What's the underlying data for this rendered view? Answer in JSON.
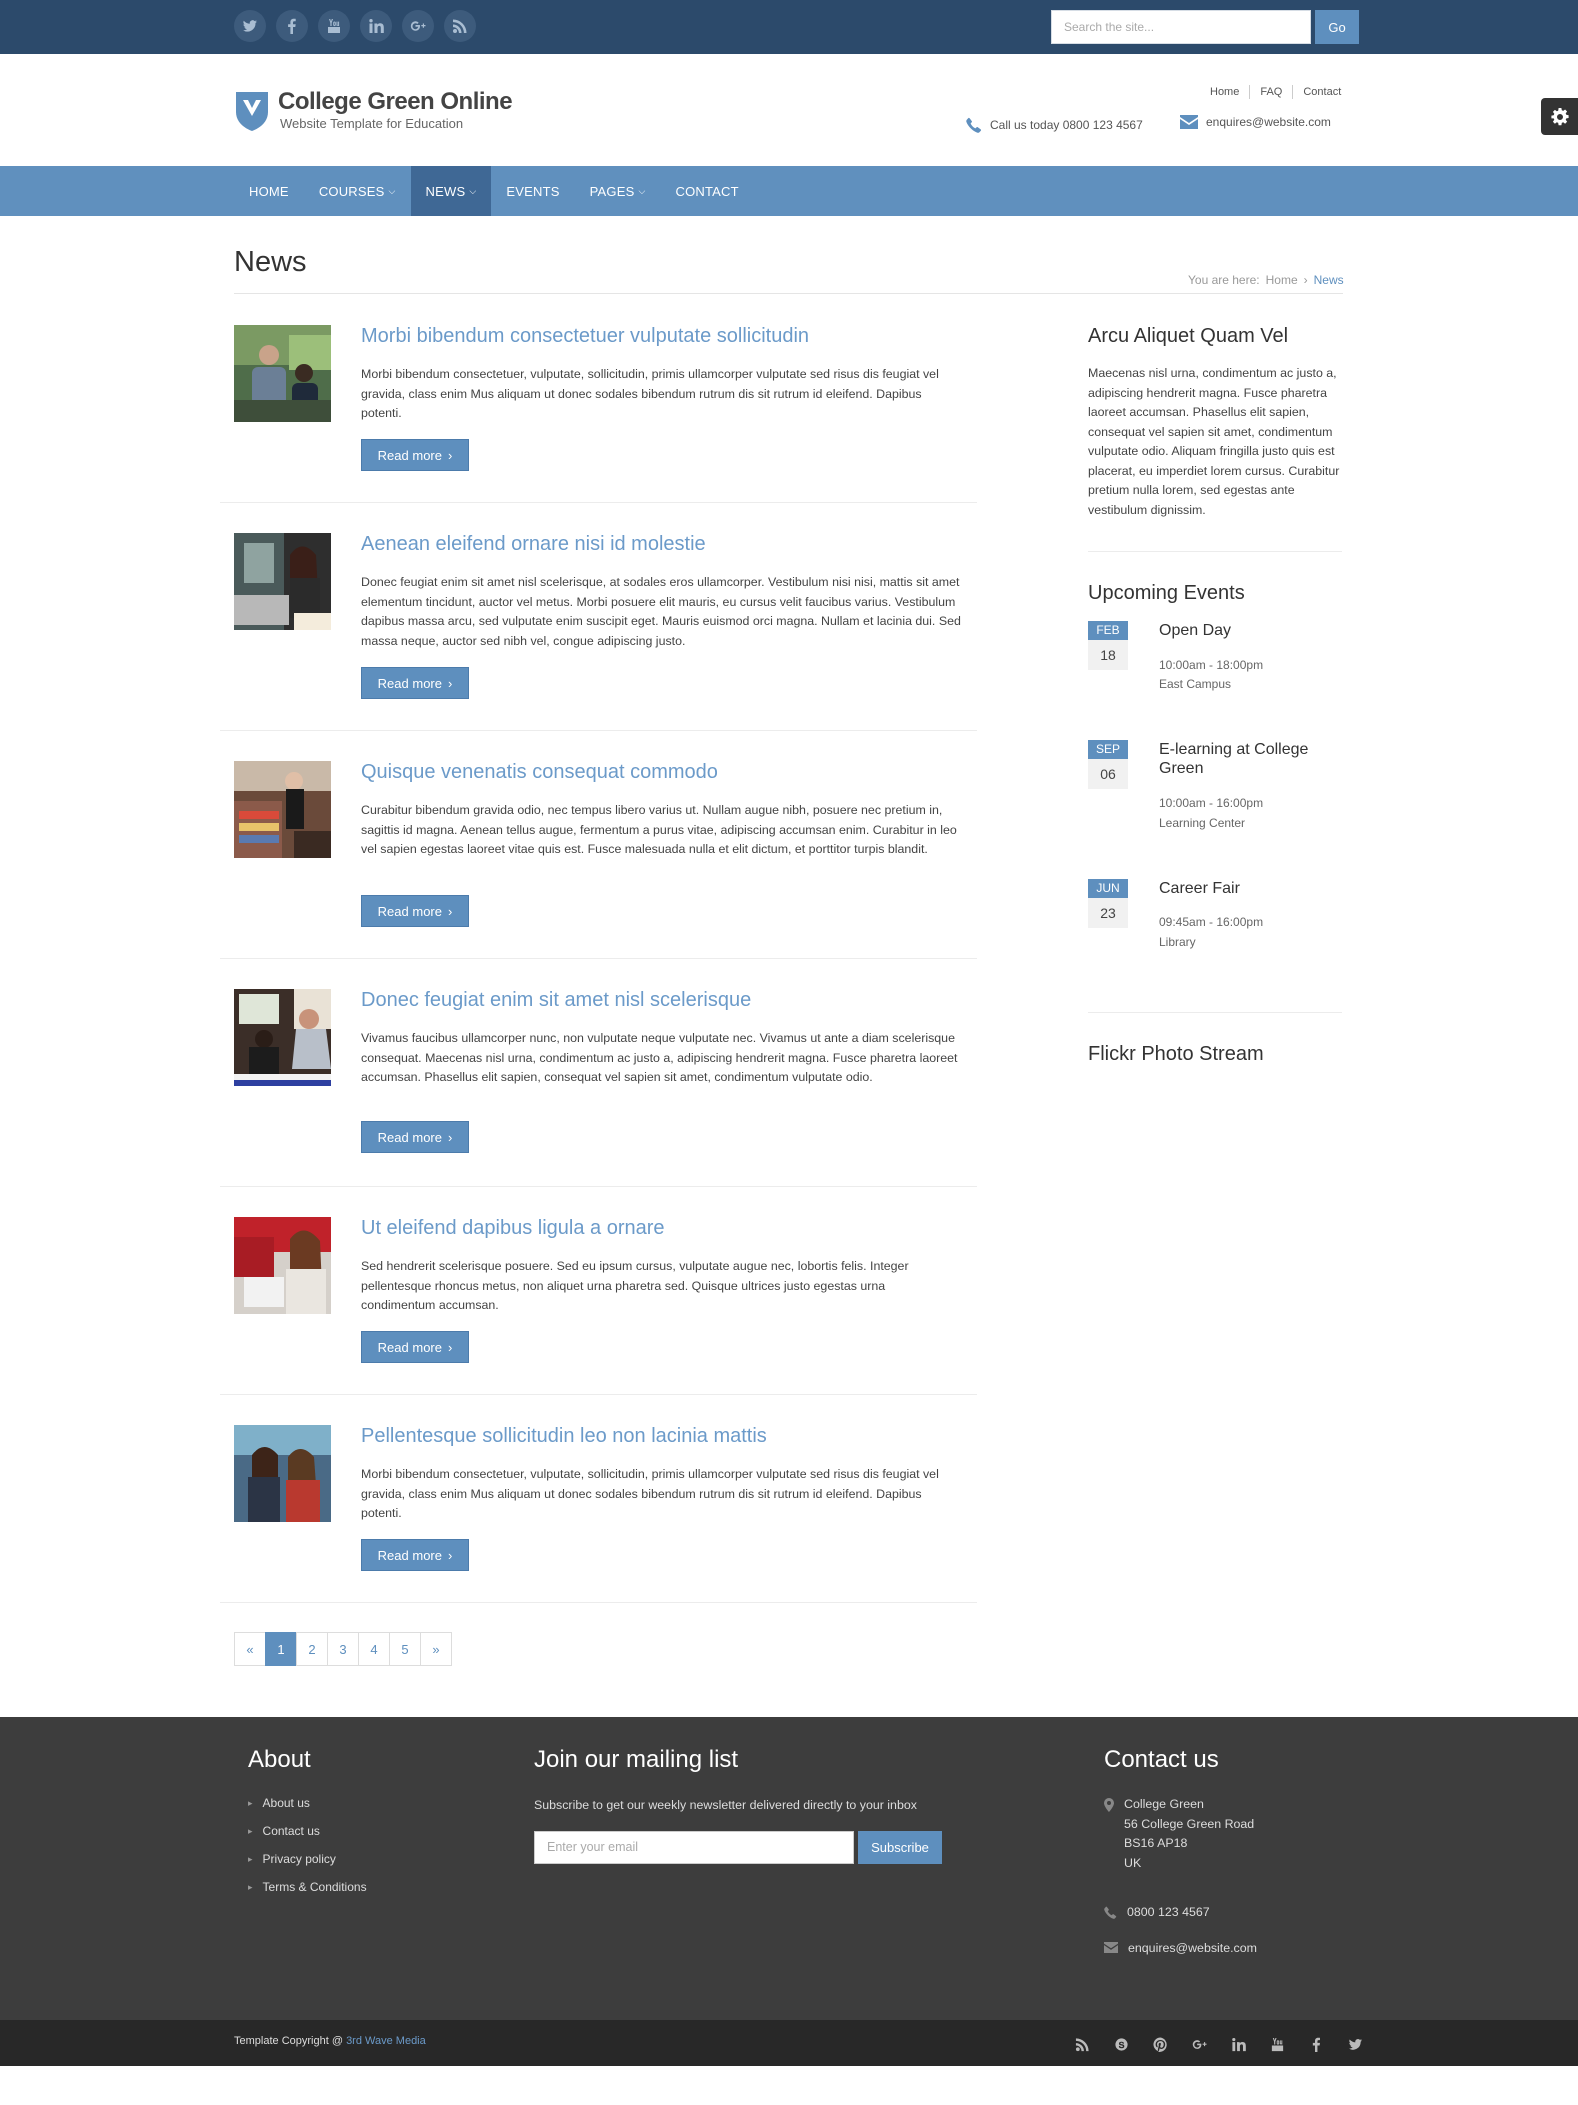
{
  "topbar": {
    "social": [
      "twitter-icon",
      "facebook-icon",
      "youtube-icon",
      "linkedin-icon",
      "google-plus-icon",
      "rss-icon"
    ],
    "search_placeholder": "Search the site...",
    "search_button": "Go"
  },
  "header": {
    "logo_title": "College Green Online",
    "logo_subtitle": "Website Template for Education",
    "links": [
      "Home",
      "FAQ",
      "Contact"
    ],
    "phone": "Call us today 0800 123 4567",
    "email": "enquires@website.com"
  },
  "nav": {
    "items": [
      {
        "label": "HOME",
        "has_caret": false
      },
      {
        "label": "COURSES",
        "has_caret": true
      },
      {
        "label": "NEWS",
        "has_caret": true,
        "active": true
      },
      {
        "label": "EVENTS",
        "has_caret": false
      },
      {
        "label": "PAGES",
        "has_caret": true
      },
      {
        "label": "CONTACT",
        "has_caret": false
      }
    ]
  },
  "page": {
    "title": "News",
    "breadcrumb_prefix": "You are here:",
    "breadcrumb_home": "Home",
    "breadcrumb_sep": "›",
    "breadcrumb_current": "News"
  },
  "posts": [
    {
      "title": "Morbi bibendum consectetuer vulputate sollicitudin",
      "excerpt": "Morbi bibendum consectetuer, vulputate, sollicitudin, primis ullamcorper vulputate sed risus dis feugiat vel gravida, class enim Mus aliquam ut donec sodales bibendum rutrum dis sit rutrum id eleifend. Dapibus potenti.",
      "button": "Read more"
    },
    {
      "title": "Aenean eleifend ornare nisi id molestie",
      "excerpt": "Donec feugiat enim sit amet nisl scelerisque, at sodales eros ullamcorper. Vestibulum nisi nisi, mattis sit amet elementum tincidunt, auctor vel metus. Morbi posuere elit mauris, eu cursus velit faucibus varius. Vestibulum dapibus massa arcu, sed vulputate enim suscipit eget. Mauris euismod orci magna. Nullam et lacinia dui. Sed massa neque, auctor sed nibh vel, congue adipiscing justo.",
      "button": "Read more"
    },
    {
      "title": "Quisque venenatis consequat commodo",
      "excerpt": "Curabitur bibendum gravida odio, nec tempus libero varius ut. Nullam augue nibh, posuere nec pretium in, sagittis id magna. Aenean tellus augue, fermentum a purus vitae, adipiscing accumsan enim. Curabitur in leo vel sapien egestas laoreet vitae quis est. Fusce malesuada nulla et elit dictum, et porttitor turpis blandit.",
      "button": "Read more"
    },
    {
      "title": "Donec feugiat enim sit amet nisl scelerisque",
      "excerpt": "Vivamus faucibus ullamcorper nunc, non vulputate neque vulputate nec. Vivamus ut ante a diam scelerisque consequat. Maecenas nisl urna, condimentum ac justo a, adipiscing hendrerit magna. Fusce pharetra laoreet accumsan. Phasellus elit sapien, consequat vel sapien sit amet, condimentum vulputate odio.",
      "button": "Read more"
    },
    {
      "title": "Ut eleifend dapibus ligula a ornare",
      "excerpt": "Sed hendrerit scelerisque posuere. Sed eu ipsum cursus, vulputate augue nec, lobortis felis. Integer pellentesque rhoncus metus, non aliquet urna pharetra sed. Quisque ultrices justo egestas urna condimentum accumsan.",
      "button": "Read more"
    },
    {
      "title": "Pellentesque sollicitudin leo non lacinia mattis",
      "excerpt": "Morbi bibendum consectetuer, vulputate, sollicitudin, primis ullamcorper vulputate sed risus dis feugiat vel gravida, class enim Mus aliquam ut donec sodales bibendum rutrum dis sit rutrum id eleifend. Dapibus potenti.",
      "button": "Read more"
    }
  ],
  "pagination": [
    "«",
    "1",
    "2",
    "3",
    "4",
    "5",
    "»"
  ],
  "pagination_active": "1",
  "sidebar": {
    "about_title": "Arcu Aliquet Quam Vel",
    "about_text": "Maecenas nisl urna, condimentum ac justo a, adipiscing hendrerit magna. Fusce pharetra laoreet accumsan. Phasellus elit sapien, consequat vel sapien sit amet, condimentum vulputate odio. Aliquam fringilla justo quis est placerat, eu imperdiet lorem cursus. Curabitur pretium nulla lorem, sed egestas ante vestibulum dignissim.",
    "events_title": "Upcoming Events",
    "events": [
      {
        "month": "FEB",
        "day": "18",
        "title": "Open Day",
        "time": "10:00am - 18:00pm",
        "location": "East Campus"
      },
      {
        "month": "SEP",
        "day": "06",
        "title": "E-learning at College Green",
        "time": "10:00am - 16:00pm",
        "location": "Learning Center"
      },
      {
        "month": "JUN",
        "day": "23",
        "title": "Career Fair",
        "time": "09:45am - 16:00pm",
        "location": "Library"
      }
    ],
    "flickr_title": "Flickr Photo Stream"
  },
  "footer": {
    "about_title": "About",
    "about_links": [
      "About us",
      "Contact us",
      "Privacy policy",
      "Terms & Conditions"
    ],
    "mailing_title": "Join our mailing list",
    "mailing_text": "Subscribe to get our weekly newsletter delivered directly to your inbox",
    "mailing_placeholder": "Enter your email",
    "mailing_button": "Subscribe",
    "contact_title": "Contact us",
    "address": [
      "College Green",
      "56 College Green Road",
      "BS16 AP18",
      "UK"
    ],
    "phone": "0800 123 4567",
    "email": "enquires@website.com",
    "copyright_prefix": "Template Copyright @",
    "copyright_link": "3rd Wave Media",
    "social": [
      "rss-icon",
      "skype-icon",
      "pinterest-icon",
      "google-plus-icon",
      "linkedin-icon",
      "youtube-icon",
      "facebook-icon",
      "twitter-icon"
    ]
  },
  "colors": {
    "topbar": "#2c4a6b",
    "nav": "#6090be",
    "nav_active": "#3f6895",
    "accent": "#5e8fbe",
    "link": "#6b9ac9",
    "footer": "#3d3d3d",
    "bottombar": "#282828"
  }
}
